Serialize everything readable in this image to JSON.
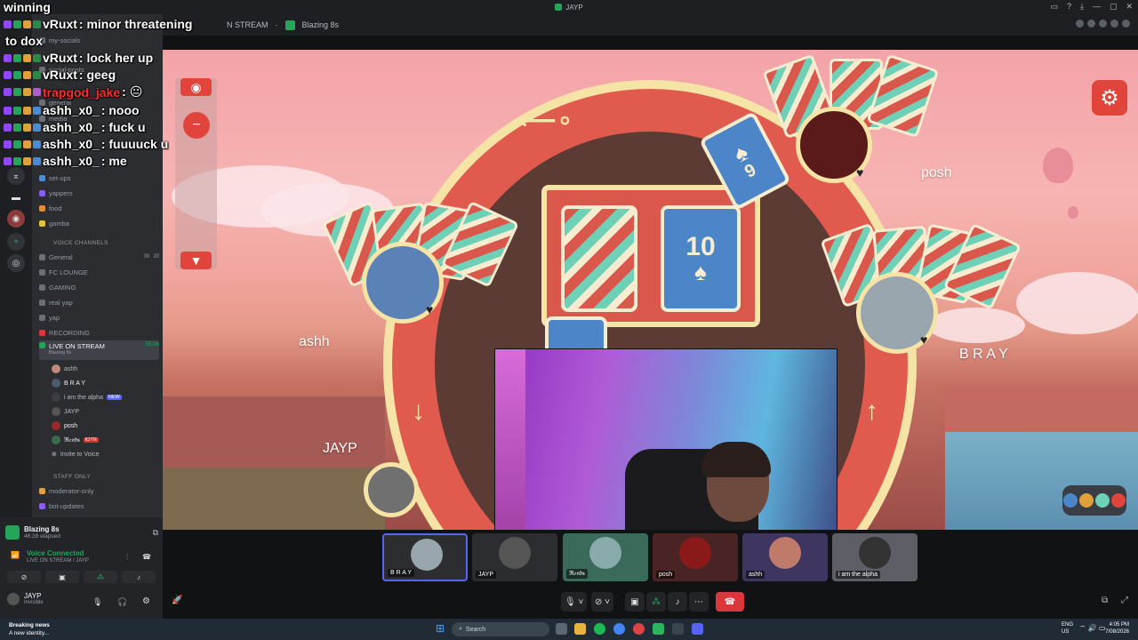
{
  "window": {
    "title": "JAYP"
  },
  "header": {
    "channel_crumb": "N STREAM",
    "activity": "Blazing 8s"
  },
  "sidebar": {
    "top_channels": [
      "my-socials",
      "social-posts",
      "general",
      "media"
    ],
    "channels": [
      "set-ups",
      "yappers",
      "food",
      "gamba"
    ],
    "voice_category": "VOICE CHANNELS",
    "voice_channels": [
      {
        "name": "General",
        "badge_a": "00",
        "badge_b": "20"
      },
      {
        "name": "FC LOUNGE"
      },
      {
        "name": "GAMING"
      },
      {
        "name": "real yap"
      },
      {
        "name": "yap"
      },
      {
        "name": "RECORDING"
      }
    ],
    "live_channel": {
      "name": "LIVE ON STREAM",
      "activity": "Blazing 8s",
      "time": "55:06"
    },
    "members": [
      {
        "name": "ashh"
      },
      {
        "name": "B R A Y"
      },
      {
        "name": "i am the alpha",
        "badge": "NEW"
      },
      {
        "name": "JAYP"
      },
      {
        "name": "posh"
      },
      {
        "name": "ℜ𝔢𝔫𝔡𝔰",
        "badge": "IOTR"
      }
    ],
    "invite": "Invite to Voice",
    "staff_category": "STAFF ONLY",
    "staff_channels": [
      "moderator-only",
      "bot-updates"
    ]
  },
  "voice_panel": {
    "activity_title": "Blazing 8s",
    "activity_sub": "46:28 elapsed",
    "connected": "Voice Connected",
    "connected_sub": "LIVE ON STREAM / JAYP",
    "user_name": "JAYP",
    "user_status": "Invisible"
  },
  "game": {
    "players": {
      "top_right": "posh",
      "left": "ashh",
      "right": "B R A Y",
      "bottom": "JAYP"
    },
    "center_card": {
      "rank": "10",
      "suit": "♠"
    },
    "played_card": {
      "rank": "9",
      "suit": "♠"
    }
  },
  "strip": {
    "tiles": [
      {
        "label": "B R A Y"
      },
      {
        "label": "JAYP"
      },
      {
        "label": "ℜ𝔢𝔫𝔡𝔰"
      },
      {
        "label": "posh"
      },
      {
        "label": "ashh"
      },
      {
        "label": "i am the alpha"
      }
    ]
  },
  "chat": [
    {
      "name": "winning",
      "text": ""
    },
    {
      "name": "vRuxt",
      "text": ": minor threatening"
    },
    {
      "name": "",
      "text": "to dox"
    },
    {
      "name": "vRuxt",
      "text": ": lock her up"
    },
    {
      "name": "vRuxt",
      "text": ": geeg"
    },
    {
      "name": "trapgod_jake",
      "text": ": 😐"
    },
    {
      "name": "ashh_x0_",
      "text": ": nooo"
    },
    {
      "name": "ashh_x0_",
      "text": ": fuck u"
    },
    {
      "name": "ashh_x0_",
      "text": ": fuuuuck u"
    },
    {
      "name": "ashh_x0_",
      "text": ": me"
    }
  ],
  "taskbar": {
    "news_title": "Breaking news",
    "news_sub": "A new identity...",
    "search": "Search",
    "lang_a": "ENG",
    "lang_b": "US",
    "time": "4:05 PM",
    "date": "7/08/2026"
  },
  "colors": {
    "accent": "#5865f2",
    "green": "#23a55a",
    "danger": "#da373c",
    "game_red": "#e0443a"
  }
}
